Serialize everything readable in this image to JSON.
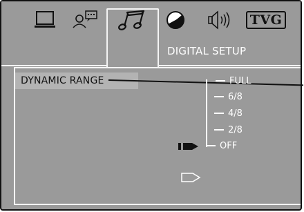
{
  "tabs": [
    {
      "icon": "monitor-icon",
      "name": "general"
    },
    {
      "icon": "person-speech-icon",
      "name": "language"
    },
    {
      "icon": "music-note-icon",
      "name": "audio",
      "active": true
    },
    {
      "icon": "half-circle-icon",
      "name": "video"
    },
    {
      "icon": "speaker-icon",
      "name": "speaker"
    },
    {
      "icon": "tvg-icon",
      "name": "rating",
      "text": "TVG"
    }
  ],
  "header": {
    "title": "DIGITAL SETUP"
  },
  "menu": {
    "item_label": "DYNAMIC  RANGE",
    "options": [
      "FULL",
      "6/8",
      "4/8",
      "2/8",
      "OFF"
    ],
    "selected": "OFF"
  },
  "markers": {
    "current": "filled-arrow-icon",
    "next": "outline-arrow-icon"
  },
  "colors": {
    "background": "#9a9a9a",
    "highlight": "#b3b3b3",
    "text_light": "#ffffff",
    "text_dark": "#111111"
  }
}
